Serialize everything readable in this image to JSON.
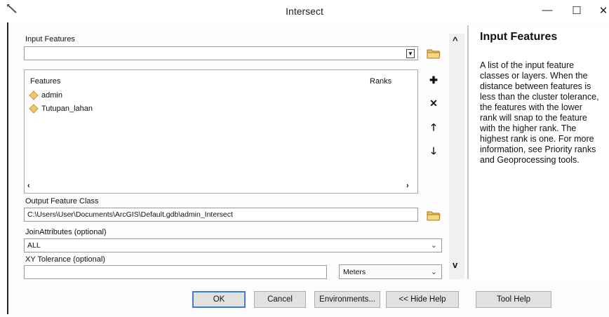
{
  "window": {
    "title": "Intersect"
  },
  "controls": {
    "minimize": "—",
    "maximize": "☐",
    "close": "✕"
  },
  "input_features": {
    "label": "Input Features",
    "value": "",
    "list": {
      "col_features": "Features",
      "col_ranks": "Ranks",
      "items": [
        "admin",
        "Tutupan_lahan"
      ]
    }
  },
  "output": {
    "label": "Output Feature Class",
    "value": "C:\\Users\\User\\Documents\\ArcGIS\\Default.gdb\\admin_Intersect"
  },
  "join": {
    "label": "JoinAttributes (optional)",
    "value": "ALL"
  },
  "xy": {
    "label": "XY Tolerance (optional)",
    "value": "",
    "units": "Meters"
  },
  "help": {
    "title": "Input Features",
    "body": "A list of the input feature classes or layers. When the distance between features is less than the cluster tolerance, the features with the lower rank will snap to the feature with the higher rank. The highest rank is one. For more information, see Priority ranks and Geoprocessing tools."
  },
  "buttons": {
    "ok": "OK",
    "cancel": "Cancel",
    "environments": "Environments...",
    "hide_help": "<< Hide Help",
    "tool_help": "Tool Help"
  },
  "colors": {
    "accent": "#3c7fd0",
    "feature_icon": "#f2c46d"
  }
}
